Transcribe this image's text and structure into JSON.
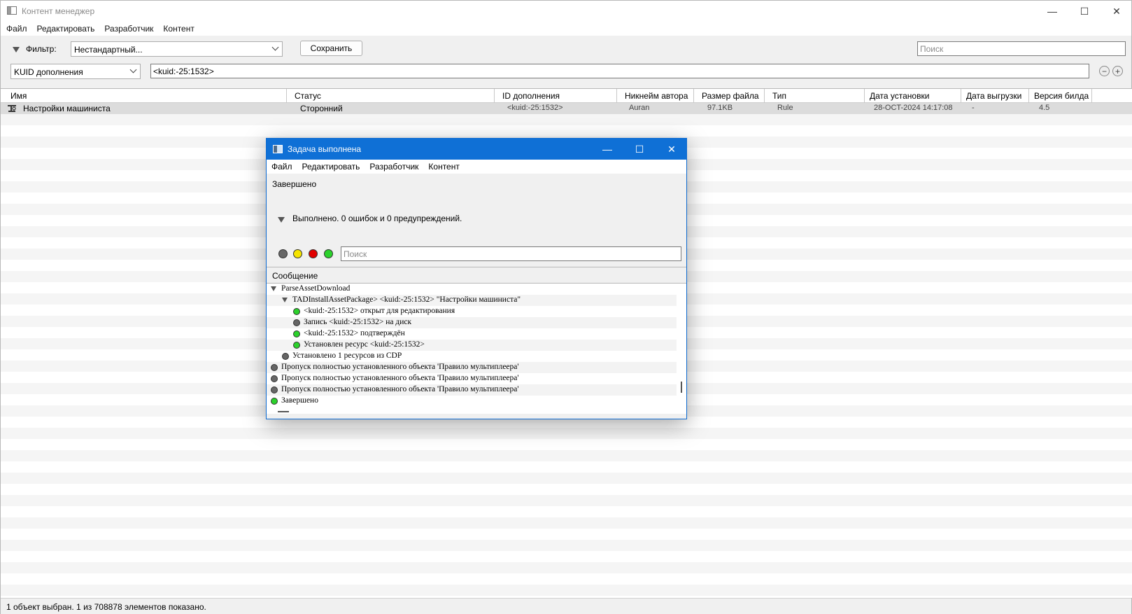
{
  "window": {
    "title": "Контент менеджер"
  },
  "menu": [
    "Файл",
    "Редактировать",
    "Разработчик",
    "Контент"
  ],
  "toolbar": {
    "filter_label": "Фильтр:",
    "filter_value": "Нестандартный...",
    "save_label": "Сохранить",
    "search_placeholder": "Поиск",
    "field_select": "KUID дополнения",
    "query_value": "<kuid:-25:1532>",
    "minus_label": "−",
    "plus_label": "+"
  },
  "grid": {
    "columns": [
      "Имя",
      "Статус",
      "ID дополнения",
      "Никнейм автора",
      "Размер файла",
      "Тип",
      "Дата установки",
      "Дата выгрузки",
      "Версия билда"
    ],
    "rows": [
      {
        "name": "Настройки машиниста",
        "status": "Сторонний",
        "id": "<kuid:-25:1532>",
        "author": "Auran",
        "size": "97.1KB",
        "type": "Rule",
        "installed": "28-OCT-2024 14:17:08",
        "uploaded": "-",
        "build": "4.5"
      }
    ]
  },
  "statusbar": {
    "text": "1 объект выбран. 1 из 708878 элементов показано."
  },
  "dialog": {
    "title": "Задача выполнена",
    "menu": [
      "Файл",
      "Редактировать",
      "Разработчик",
      "Контент"
    ],
    "status": "Завершено",
    "result": "Выполнено. 0 ошибок и 0 предупреждений.",
    "search_placeholder": "Поиск",
    "message_header": "Сообщение",
    "messages": [
      {
        "text": "ParseAssetDownload",
        "level": 0,
        "marker": "expander"
      },
      {
        "text": "TADInstallAssetPackage> <kuid:-25:1532> \"Настройки машиниста\"",
        "level": 1,
        "marker": "expander"
      },
      {
        "text": "<kuid:-25:1532> открыт для редактирования",
        "level": 2,
        "marker": "green"
      },
      {
        "text": "Запись <kuid:-25:1532> на диск",
        "level": 2,
        "marker": "gray"
      },
      {
        "text": "<kuid:-25:1532> подтверждён",
        "level": 2,
        "marker": "green"
      },
      {
        "text": "Установлен ресурс <kuid:-25:1532>",
        "level": 2,
        "marker": "green"
      },
      {
        "text": "Установлено 1 ресурсов из CDP",
        "level": 1,
        "marker": "gray"
      },
      {
        "text": "Пропуск полностью установленного объекта 'Правило мультиплеера'",
        "level": 0,
        "marker": "gray"
      },
      {
        "text": "Пропуск полностью установленного объекта 'Правило мультиплеера'",
        "level": 0,
        "marker": "gray"
      },
      {
        "text": "Пропуск полностью установленного объекта 'Правило мультиплеера'",
        "level": 0,
        "marker": "gray"
      },
      {
        "text": "Завершено",
        "level": 0,
        "marker": "green"
      }
    ],
    "filter_dot_colors": {
      "gray": "#666666",
      "yellow": "#f5e400",
      "red": "#e00000",
      "green": "#2bd12b"
    }
  }
}
